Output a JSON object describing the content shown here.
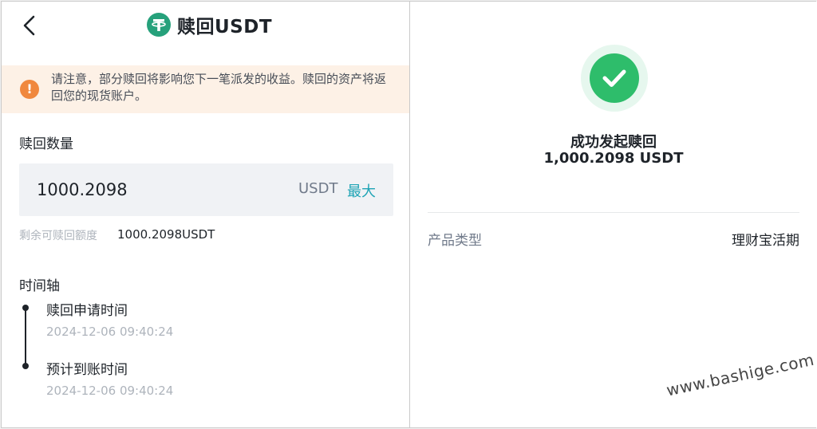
{
  "left": {
    "title": "赎回USDT",
    "notice": "请注意，部分赎回将影响您下一笔派发的收益。赎回的资产将返回您的现货账户。",
    "amount_label": "赎回数量",
    "amount_value": "1000.2098",
    "unit": "USDT",
    "max_label": "最大",
    "remaining_label": "剩余可赎回额度",
    "remaining_value": "1000.2098USDT",
    "timeline_label": "时间轴",
    "timeline": [
      {
        "title": "赎回申请时间",
        "time": "2024-12-06 09:40:24"
      },
      {
        "title": "预计到账时间",
        "time": "2024-12-06 09:40:24"
      }
    ]
  },
  "right": {
    "success_title": "成功发起赎回",
    "success_amount": "1,000.2098 USDT",
    "product_type_label": "产品类型",
    "product_type_value": "理财宝活期"
  },
  "watermark": "www.bashige.com",
  "colors": {
    "success": "#2ebd6b",
    "link": "#1fa4b5",
    "warning": "#f0883e",
    "notice_bg": "#fdf1e6",
    "tether": "#26a17b"
  },
  "icons": [
    "back-arrow-icon",
    "tether-logo-icon",
    "warning-icon",
    "success-check-icon"
  ]
}
